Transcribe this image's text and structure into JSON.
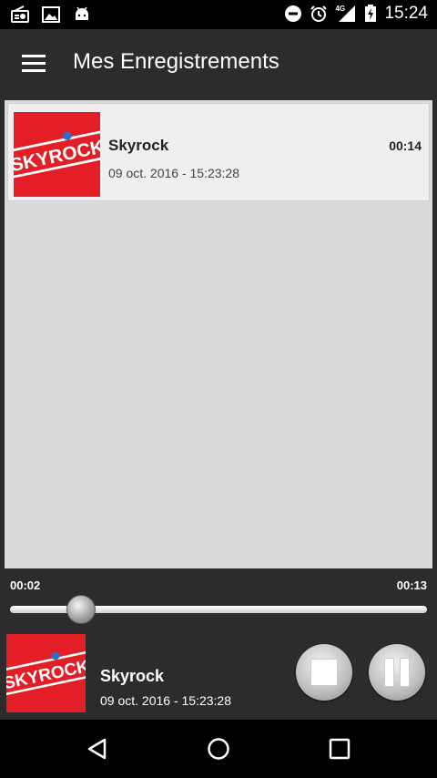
{
  "status_bar": {
    "time": "15:24",
    "network": "4G"
  },
  "app_bar": {
    "title": "Mes Enregistrements"
  },
  "logo_text": "SKYROCK",
  "recordings": [
    {
      "name": "Skyrock",
      "date": "09 oct. 2016 - 15:23:28",
      "duration": "00:14"
    }
  ],
  "player": {
    "elapsed": "00:02",
    "total": "00:13",
    "progress": 0.17,
    "name": "Skyrock",
    "date": "09 oct. 2016 - 15:23:28"
  },
  "colors": {
    "brand_red": "#e41e26",
    "bar_dark": "#2c2c2c",
    "list_bg": "#dadada"
  }
}
